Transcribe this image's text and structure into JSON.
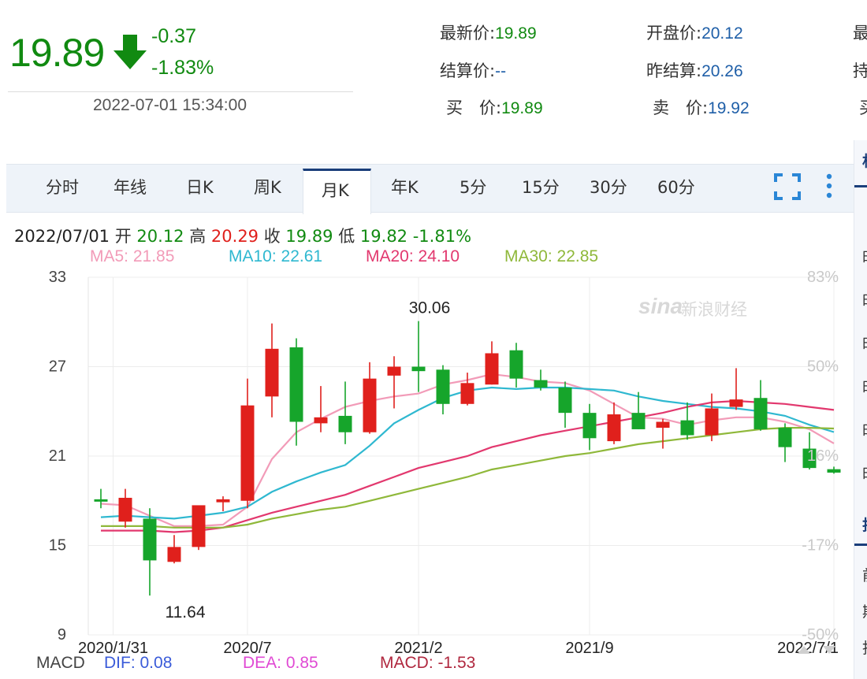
{
  "quote": {
    "price": "19.89",
    "change": "-0.37",
    "change_pct": "-1.83%",
    "time": "2022-07-01 15:34:00",
    "fields": [
      {
        "label": "最新价:",
        "value": "19.89"
      },
      {
        "label": "开盘价:",
        "value": "20.12"
      },
      {
        "label": "结算价:",
        "value": "--"
      },
      {
        "label": "昨结算:",
        "value": "20.26"
      },
      {
        "label": "买　价:",
        "value": "19.89"
      },
      {
        "label": "卖　价:",
        "value": "19.92"
      }
    ],
    "cut_labels": [
      "最",
      "持",
      "买"
    ]
  },
  "tabs": [
    "分时",
    "年线",
    "日K",
    "周K",
    "月K",
    "年K",
    "5分",
    "15分",
    "30分",
    "60分"
  ],
  "active_tab": "月K",
  "side_chars": [
    "相",
    "时",
    "时",
    "时",
    "时",
    "时",
    "时",
    "技",
    "前",
    "期",
    "指"
  ],
  "info": {
    "date": "2022/07/01",
    "open_label": "开",
    "open": "20.12",
    "high_label": "高",
    "high": "20.29",
    "close_label": "收",
    "close": "19.89",
    "low_label": "低",
    "low": "19.82",
    "pct": "-1.81%"
  },
  "ma": [
    {
      "label": "MA5: 21.85",
      "color": "#f29bb8"
    },
    {
      "label": "MA10: 22.61",
      "color": "#2fb8d0"
    },
    {
      "label": "MA20: 24.10",
      "color": "#e2386e"
    },
    {
      "label": "MA30: 22.85",
      "color": "#8fb83a"
    }
  ],
  "watermark": "新浪财经",
  "macd": {
    "title": "MACD",
    "dif": "DIF: 0.08",
    "dea": "DEA: 0.85",
    "macd": "MACD: -1.53"
  },
  "chart_data": {
    "type": "candlestick",
    "ylim": [
      9,
      33
    ],
    "y_ticks": [
      "33",
      "27",
      "21",
      "15",
      "9"
    ],
    "pct_ticks": [
      "83%",
      "50%",
      "16%",
      "-17%",
      "-50%"
    ],
    "x_labels": [
      {
        "label": "2020/1/31",
        "index": 0.5
      },
      {
        "label": "2020/7",
        "index": 6
      },
      {
        "label": "2021/2",
        "index": 13
      },
      {
        "label": "2021/9",
        "index": 20
      },
      {
        "label": "2022/7/1",
        "index": 30
      }
    ],
    "annotations": [
      {
        "text": "30.06",
        "index": 13,
        "value": 30.06,
        "pos": "above"
      },
      {
        "text": "11.64",
        "index": 3,
        "value": 11.64,
        "pos": "below"
      }
    ],
    "candles": [
      {
        "o": 18.1,
        "h": 18.8,
        "l": 17.5,
        "c": 18.0
      },
      {
        "o": 16.6,
        "h": 18.8,
        "l": 16.2,
        "c": 18.2
      },
      {
        "o": 16.8,
        "h": 17.5,
        "l": 11.64,
        "c": 14.0
      },
      {
        "o": 13.9,
        "h": 15.7,
        "l": 13.8,
        "c": 14.9
      },
      {
        "o": 14.9,
        "h": 17.4,
        "l": 14.7,
        "c": 17.7
      },
      {
        "o": 17.9,
        "h": 18.3,
        "l": 17.3,
        "c": 18.1
      },
      {
        "o": 18.0,
        "h": 26.2,
        "l": 17.5,
        "c": 24.4
      },
      {
        "o": 25.0,
        "h": 29.9,
        "l": 23.6,
        "c": 28.2
      },
      {
        "o": 28.3,
        "h": 28.9,
        "l": 21.7,
        "c": 23.3
      },
      {
        "o": 23.2,
        "h": 25.7,
        "l": 22.6,
        "c": 23.6
      },
      {
        "o": 23.7,
        "h": 26.0,
        "l": 21.8,
        "c": 22.6
      },
      {
        "o": 22.6,
        "h": 27.3,
        "l": 22.5,
        "c": 26.2
      },
      {
        "o": 26.4,
        "h": 27.7,
        "l": 24.2,
        "c": 27.0
      },
      {
        "o": 27.0,
        "h": 30.06,
        "l": 25.3,
        "c": 26.7
      },
      {
        "o": 26.8,
        "h": 27.1,
        "l": 23.8,
        "c": 24.5
      },
      {
        "o": 24.5,
        "h": 26.6,
        "l": 24.4,
        "c": 25.9
      },
      {
        "o": 25.8,
        "h": 28.7,
        "l": 25.8,
        "c": 27.9
      },
      {
        "o": 28.1,
        "h": 28.6,
        "l": 25.6,
        "c": 26.2
      },
      {
        "o": 26.1,
        "h": 26.8,
        "l": 25.4,
        "c": 25.6
      },
      {
        "o": 25.6,
        "h": 26.0,
        "l": 22.9,
        "c": 23.9
      },
      {
        "o": 23.9,
        "h": 24.5,
        "l": 21.4,
        "c": 22.2
      },
      {
        "o": 22.0,
        "h": 24.6,
        "l": 21.8,
        "c": 23.8
      },
      {
        "o": 23.9,
        "h": 25.3,
        "l": 22.8,
        "c": 22.8
      },
      {
        "o": 22.9,
        "h": 23.5,
        "l": 21.5,
        "c": 23.3
      },
      {
        "o": 23.4,
        "h": 24.6,
        "l": 22.1,
        "c": 22.4
      },
      {
        "o": 22.4,
        "h": 25.2,
        "l": 22.0,
        "c": 24.2
      },
      {
        "o": 24.3,
        "h": 26.9,
        "l": 24.1,
        "c": 24.8
      },
      {
        "o": 24.9,
        "h": 26.1,
        "l": 22.7,
        "c": 22.8
      },
      {
        "o": 22.9,
        "h": 23.2,
        "l": 20.6,
        "c": 21.6
      },
      {
        "o": 21.5,
        "h": 22.6,
        "l": 20.1,
        "c": 20.2
      },
      {
        "o": 20.12,
        "h": 20.29,
        "l": 19.82,
        "c": 19.89
      }
    ],
    "series": [
      {
        "name": "MA5",
        "color": "#f29bb8",
        "values": [
          17.8,
          17.7,
          17.0,
          16.3,
          16.3,
          16.4,
          17.6,
          20.8,
          22.6,
          23.5,
          24.3,
          24.7,
          25.0,
          25.2,
          25.8,
          26.1,
          26.5,
          26.3,
          26.0,
          25.9,
          25.4,
          24.5,
          23.6,
          23.5,
          23.1,
          23.4,
          23.6,
          23.6,
          23.3,
          22.8,
          21.85
        ]
      },
      {
        "name": "MA10",
        "color": "#2fb8d0",
        "values": [
          16.9,
          17.0,
          16.9,
          16.8,
          17.0,
          17.2,
          17.6,
          18.6,
          19.3,
          19.9,
          20.4,
          21.7,
          23.2,
          24.1,
          24.9,
          25.4,
          25.6,
          25.5,
          25.6,
          25.6,
          25.5,
          25.4,
          25.0,
          24.7,
          24.5,
          24.3,
          24.2,
          24.0,
          23.7,
          23.1,
          22.61
        ]
      },
      {
        "name": "MA20",
        "color": "#e2386e",
        "values": [
          16.0,
          16.0,
          16.0,
          15.9,
          16.0,
          16.2,
          16.7,
          17.2,
          17.6,
          18.0,
          18.4,
          19.0,
          19.6,
          20.2,
          20.6,
          21.0,
          21.6,
          22.0,
          22.4,
          22.7,
          23.0,
          23.3,
          23.6,
          23.9,
          24.3,
          24.6,
          24.7,
          24.6,
          24.5,
          24.3,
          24.1
        ]
      },
      {
        "name": "MA30",
        "color": "#8fb83a",
        "values": [
          16.3,
          16.3,
          16.3,
          16.2,
          16.2,
          16.2,
          16.4,
          16.8,
          17.1,
          17.4,
          17.6,
          18.0,
          18.4,
          18.8,
          19.2,
          19.6,
          20.1,
          20.4,
          20.7,
          21.0,
          21.2,
          21.5,
          21.8,
          22.0,
          22.2,
          22.4,
          22.6,
          22.8,
          22.9,
          22.9,
          22.85
        ]
      }
    ]
  }
}
